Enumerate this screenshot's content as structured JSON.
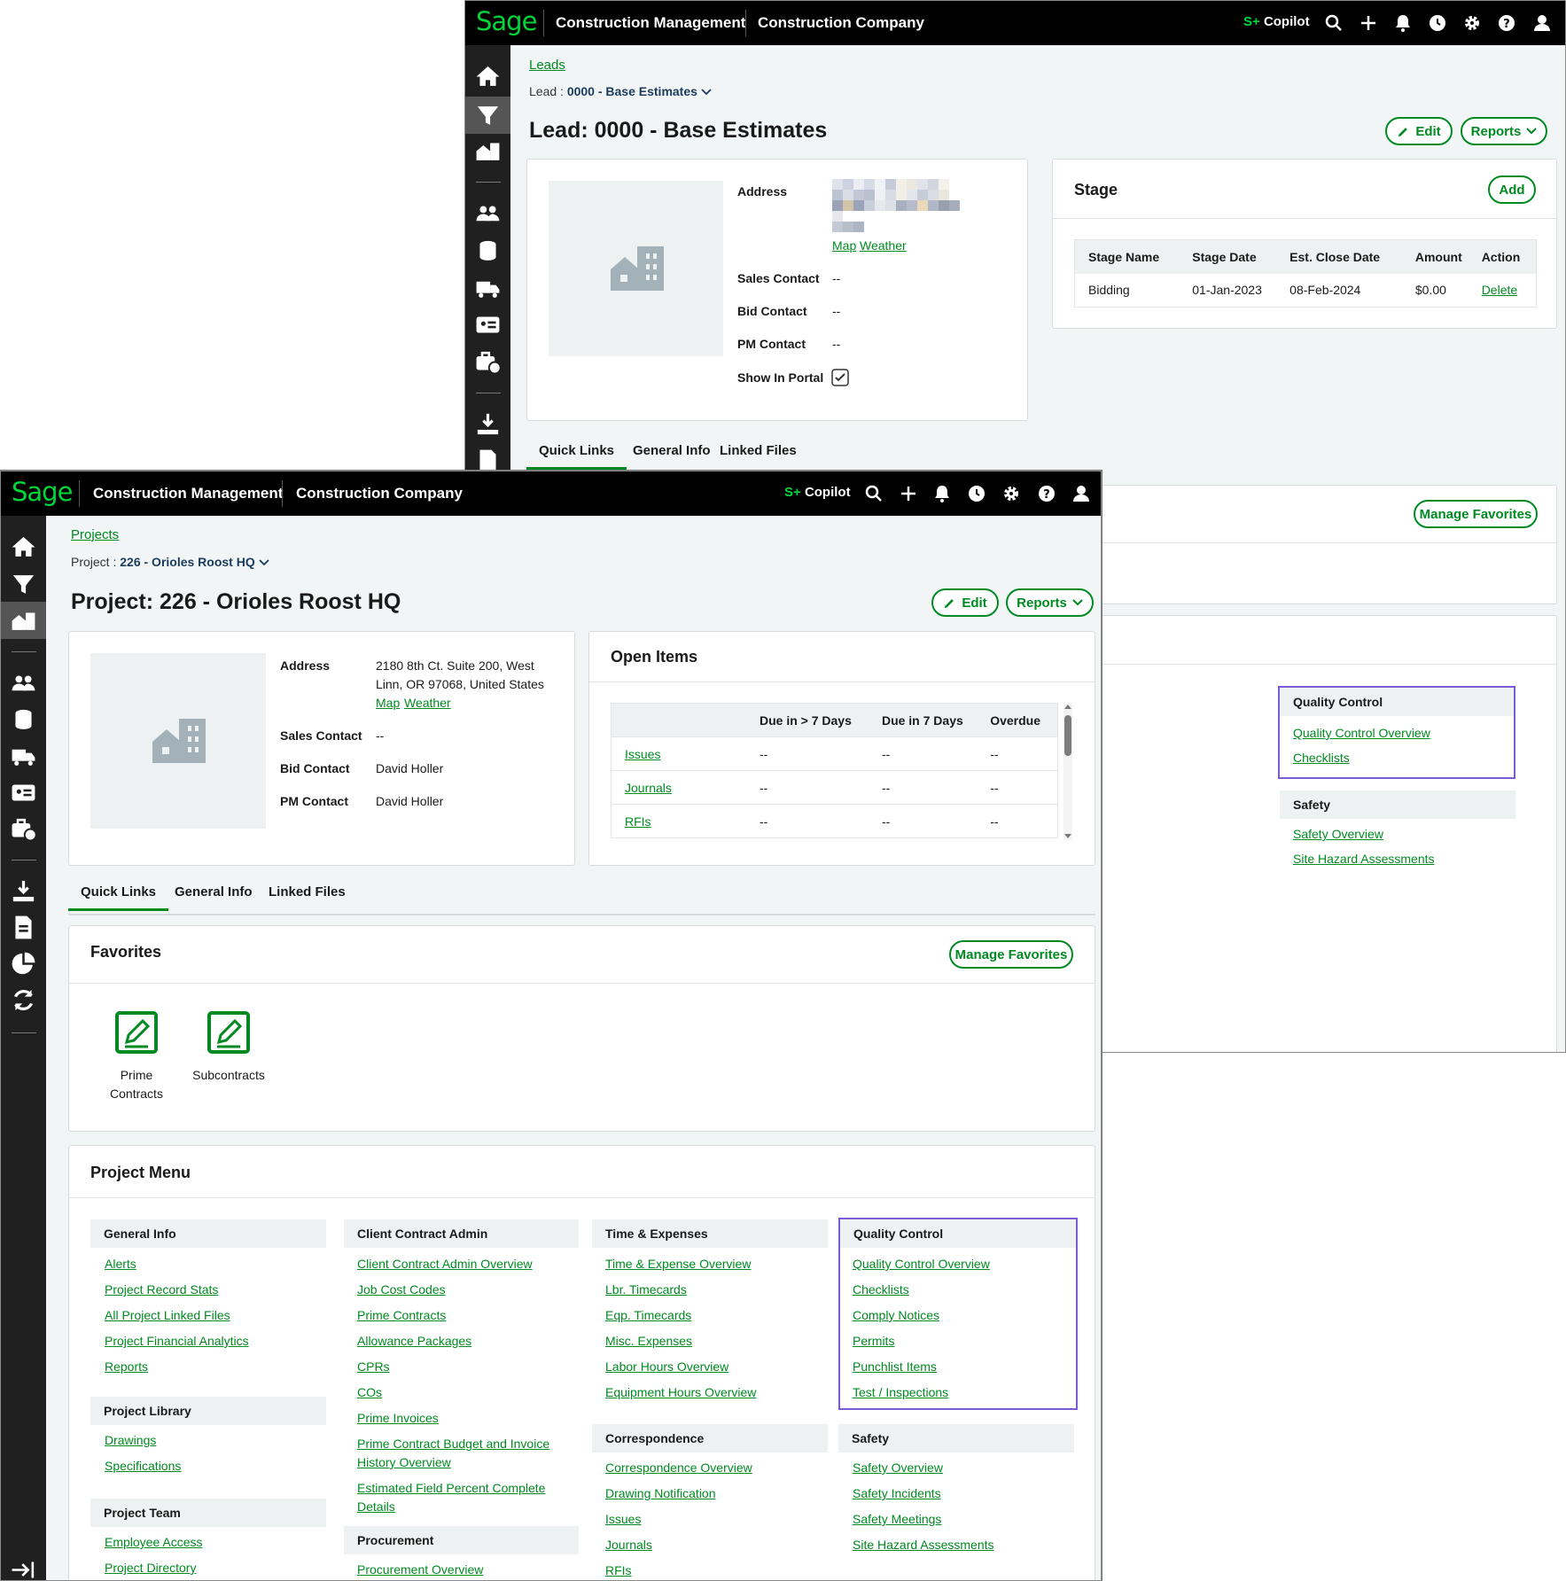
{
  "app": {
    "logo": "Sage",
    "product": "Construction Management",
    "company": "Construction Company",
    "copilot_mark": "S+",
    "copilot_label": "Copilot"
  },
  "lead": {
    "breadcrumb": "Leads",
    "sub_prefix": "Lead :",
    "sub_value": "0000 - Base Estimates",
    "title": "Lead: 0000 - Base Estimates",
    "edit_label": "Edit",
    "reports_label": "Reports",
    "address_label": "Address",
    "map_link": "Map",
    "weather_link": "Weather",
    "sales_contact_label": "Sales Contact",
    "sales_contact_value": "--",
    "bid_contact_label": "Bid Contact",
    "bid_contact_value": "--",
    "pm_contact_label": "PM Contact",
    "pm_contact_value": "--",
    "show_in_portal_label": "Show In Portal",
    "stage": {
      "title": "Stage",
      "add_label": "Add",
      "columns": [
        "Stage Name",
        "Stage Date",
        "Est. Close Date",
        "Amount",
        "Action"
      ],
      "rows": [
        {
          "name": "Bidding",
          "date": "01-Jan-2023",
          "close": "08-Feb-2024",
          "amount": "$0.00",
          "action": "Delete"
        }
      ]
    },
    "tabs": [
      "Quick Links",
      "General Info",
      "Linked Files"
    ],
    "manage_favorites": "Manage Favorites",
    "qc_header": "Quality Control",
    "qc_links": [
      "Quality Control Overview",
      "Checklists"
    ],
    "safety_header": "Safety",
    "safety_links": [
      "Safety Overview",
      "Site Hazard Assessments"
    ]
  },
  "project": {
    "breadcrumb": "Projects",
    "sub_prefix": "Project :",
    "sub_value": "226 - Orioles Roost HQ",
    "title": "Project: 226 - Orioles Roost HQ",
    "edit_label": "Edit",
    "reports_label": "Reports",
    "address_label": "Address",
    "address_line1": "2180 8th Ct. Suite 200, West",
    "address_line2": "Linn, OR 97068, United States",
    "map_link": "Map",
    "weather_link": "Weather",
    "sales_contact_label": "Sales Contact",
    "sales_contact_value": "--",
    "bid_contact_label": "Bid Contact",
    "bid_contact_value": "David Holler",
    "pm_contact_label": "PM Contact",
    "pm_contact_value": "David Holler",
    "open_items": {
      "title": "Open Items",
      "columns": [
        "",
        "Due in > 7 Days",
        "Due in 7 Days",
        "Overdue"
      ],
      "rows": [
        {
          "name": "Issues",
          "gt7": "--",
          "in7": "--",
          "overdue": "--"
        },
        {
          "name": "Journals",
          "gt7": "--",
          "in7": "--",
          "overdue": "--"
        },
        {
          "name": "RFIs",
          "gt7": "--",
          "in7": "--",
          "overdue": "--"
        }
      ]
    },
    "tabs": [
      "Quick Links",
      "General Info",
      "Linked Files"
    ],
    "favorites": {
      "title": "Favorites",
      "manage_label": "Manage Favorites",
      "items": [
        {
          "line1": "Prime",
          "line2": "Contracts"
        },
        {
          "line1": "Subcontracts",
          "line2": ""
        }
      ]
    },
    "menu": {
      "title": "Project Menu",
      "general_info": {
        "header": "General Info",
        "links": [
          "Alerts",
          "Project Record Stats",
          "All Project Linked Files",
          "Project Financial Analytics",
          "Reports"
        ]
      },
      "project_library": {
        "header": "Project Library",
        "links": [
          "Drawings",
          "Specifications"
        ]
      },
      "project_team": {
        "header": "Project Team",
        "links": [
          "Employee Access",
          "Project Directory"
        ]
      },
      "client_contract": {
        "header": "Client Contract Admin",
        "links": [
          "Client Contract Admin Overview",
          "Job Cost Codes",
          "Prime Contracts",
          "Allowance Packages",
          "CPRs",
          "COs",
          "Prime Invoices",
          "Prime Contract Budget and Invoice History Overview",
          "Estimated Field Percent Complete Details"
        ]
      },
      "procurement": {
        "header": "Procurement",
        "links": [
          "Procurement Overview"
        ]
      },
      "time_expenses": {
        "header": "Time & Expenses",
        "links": [
          "Time & Expense Overview",
          "Lbr. Timecards",
          "Eqp. Timecards",
          "Misc. Expenses",
          "Labor Hours Overview",
          "Equipment Hours Overview"
        ]
      },
      "correspondence": {
        "header": "Correspondence",
        "links": [
          "Correspondence Overview",
          "Drawing Notification",
          "Issues",
          "Journals",
          "RFIs"
        ]
      },
      "quality_control": {
        "header": "Quality Control",
        "links": [
          "Quality Control Overview",
          "Checklists",
          "Comply Notices",
          "Permits",
          "Punchlist Items",
          "Test / Inspections"
        ]
      },
      "safety": {
        "header": "Safety",
        "links": [
          "Safety Overview",
          "Safety Incidents",
          "Safety Meetings",
          "Site Hazard Assessments"
        ]
      }
    }
  },
  "icons": [
    "home-icon",
    "filter-icon",
    "building-icon",
    "people-icon",
    "coins-icon",
    "truck-icon",
    "id-card-icon",
    "briefcase-clock-icon",
    "download-icon",
    "document-icon",
    "pie-chart-icon",
    "refresh-icon",
    "collapse-icon",
    "search-icon",
    "plus-icon",
    "bell-icon",
    "clock-icon",
    "gear-icon",
    "help-icon",
    "user-icon",
    "pencil-icon",
    "chevron-down-icon",
    "checkbox-icon"
  ],
  "colors": {
    "brand_green": "#00d639",
    "link_green": "#008a21",
    "topbar": "#000000",
    "sidebar": "#202020",
    "highlight_purple": "#7c5cd6"
  }
}
